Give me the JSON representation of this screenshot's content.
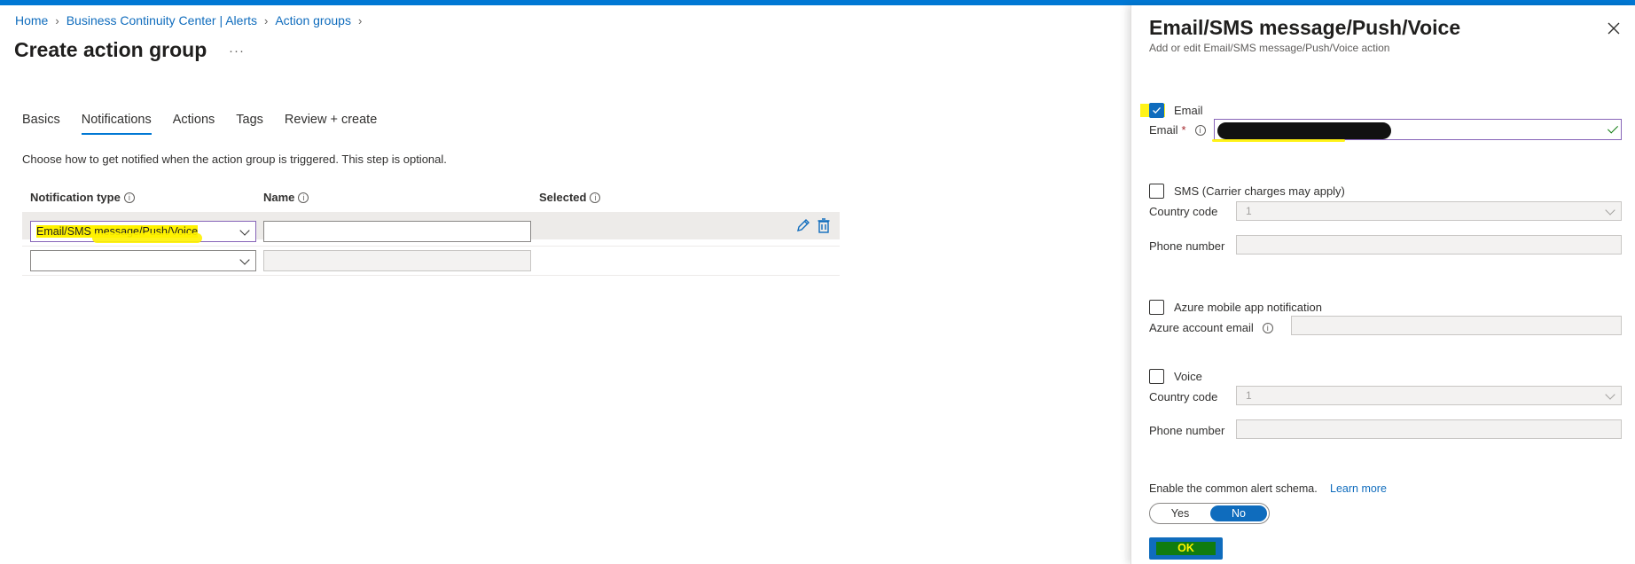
{
  "breadcrumb": {
    "items": [
      "Home",
      "Business Continuity Center | Alerts",
      "Action groups"
    ]
  },
  "page": {
    "title": "Create action group",
    "more": "···"
  },
  "tabs": [
    {
      "label": "Basics"
    },
    {
      "label": "Notifications",
      "active": true
    },
    {
      "label": "Actions"
    },
    {
      "label": "Tags"
    },
    {
      "label": "Review + create"
    }
  ],
  "intro": "Choose how to get notified when the action group is triggered. This step is optional.",
  "table": {
    "headers": {
      "notification_type": "Notification type",
      "name": "Name",
      "selected": "Selected"
    },
    "rows": [
      {
        "notification_type": "Email/SMS message/Push/Voice",
        "name": "",
        "selected": ""
      },
      {
        "notification_type": "",
        "name": "",
        "selected": ""
      }
    ]
  },
  "panel": {
    "title": "Email/SMS message/Push/Voice",
    "subtitle": "Add or edit Email/SMS message/Push/Voice action",
    "email": {
      "checkbox_label": "Email",
      "checked": true,
      "field_label": "Email",
      "required_mark": "*"
    },
    "sms": {
      "checkbox_label": "SMS (Carrier charges may apply)",
      "checked": false,
      "country_label": "Country code",
      "country_value": "1",
      "phone_label": "Phone number"
    },
    "azure_app": {
      "checkbox_label": "Azure mobile app notification",
      "checked": false,
      "account_label": "Azure account email"
    },
    "voice": {
      "checkbox_label": "Voice",
      "checked": false,
      "country_label": "Country code",
      "country_value": "1",
      "phone_label": "Phone number"
    },
    "schema": {
      "label": "Enable the common alert schema.",
      "learn_more": "Learn more",
      "yes": "Yes",
      "no": "No",
      "selected": "No"
    },
    "ok_label": "OK"
  },
  "colors": {
    "accent": "#0f6cbd",
    "highlight": "#fff200",
    "focus_border": "#8764b8"
  }
}
